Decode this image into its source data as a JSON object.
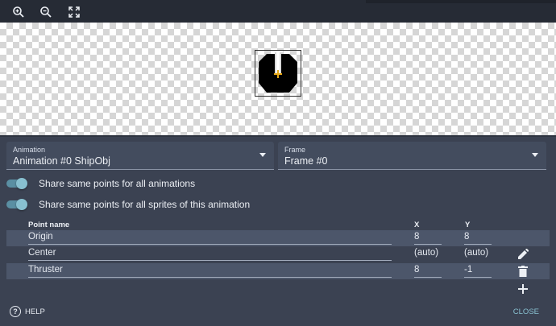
{
  "toolbar": {
    "icons": [
      "zoom-in-icon",
      "zoom-out-icon",
      "fullscreen-icon"
    ]
  },
  "animation_select": {
    "label": "Animation",
    "value": "Animation #0 ShipObj"
  },
  "frame_select": {
    "label": "Frame",
    "value": "Frame #0"
  },
  "toggles": [
    {
      "label": "Share same points for all animations",
      "on": true
    },
    {
      "label": "Share same points for all sprites of this animation",
      "on": true
    }
  ],
  "table": {
    "headers": {
      "name": "Point name",
      "x": "X",
      "y": "Y"
    },
    "rows": [
      {
        "name": "Origin",
        "x": "8",
        "y": "8"
      },
      {
        "name": "Center",
        "x": "(auto)",
        "y": "(auto)"
      },
      {
        "name": "Thruster",
        "x": "8",
        "y": "-1"
      }
    ]
  },
  "footer": {
    "help": "HELP",
    "help_glyph": "?",
    "close": "CLOSE"
  },
  "colors": {
    "accent": "#88c0d0",
    "panel": "#3b4252",
    "row_alt": "#4c566a"
  }
}
